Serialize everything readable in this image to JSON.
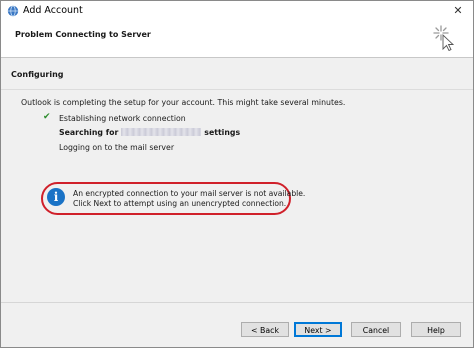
{
  "window": {
    "title": "Add Account",
    "close_symbol": "✕"
  },
  "header": {
    "title": "Problem Connecting to Server"
  },
  "content": {
    "section_title": "Configuring",
    "description": "Outlook is completing the setup for your account. This might take several minutes.",
    "steps": [
      {
        "text": "Establishing network connection",
        "status": "done"
      },
      {
        "prefix": "Searching for",
        "suffix": "settings",
        "status": "in-progress"
      },
      {
        "text": "Logging on to the mail server",
        "status": "pending"
      }
    ],
    "info": {
      "line1": "An encrypted connection to your mail server is not available.",
      "line2": "Click Next to attempt using an unencrypted connection.",
      "icon_glyph": "i"
    }
  },
  "buttons": {
    "back": "< Back",
    "next": "Next >",
    "cancel": "Cancel",
    "help": "Help"
  },
  "colors": {
    "accent": "#0078d7",
    "info_icon": "#1a73c6",
    "highlight_oval": "#d0202a",
    "check": "#2c8c2c"
  }
}
